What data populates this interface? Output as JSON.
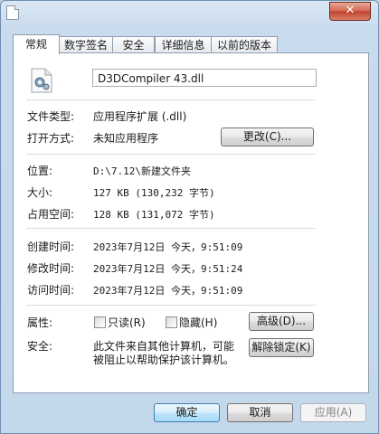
{
  "window": {
    "close_label": "✕"
  },
  "tabs": [
    {
      "label": "常规",
      "active": true
    },
    {
      "label": "数字签名"
    },
    {
      "label": "安全"
    },
    {
      "label": "详细信息"
    },
    {
      "label": "以前的版本"
    }
  ],
  "general": {
    "filename": "D3DCompiler 43.dll",
    "file_type_label": "文件类型:",
    "file_type_value": "应用程序扩展 (.dll)",
    "open_with_label": "打开方式:",
    "open_with_value": "未知应用程序",
    "change_button": "更改(C)...",
    "location_label": "位置:",
    "location_value": "D:\\7.12\\新建文件夹",
    "size_label": "大小:",
    "size_value": "127 KB (130,232 字节)",
    "size_on_disk_label": "占用空间:",
    "size_on_disk_value": "128 KB (131,072 字节)",
    "created_label": "创建时间:",
    "created_value": "2023年7月12日 今天，9:51:09",
    "modified_label": "修改时间:",
    "modified_value": "2023年7月12日 今天，9:51:24",
    "accessed_label": "访问时间:",
    "accessed_value": "2023年7月12日 今天，9:51:09",
    "attributes_label": "属性:",
    "readonly_label": "只读(R)",
    "hidden_label": "隐藏(H)",
    "advanced_button": "高级(D)...",
    "security_label": "安全:",
    "security_text_line1": "此文件来自其他计算机，可能",
    "security_text_line2": "被阻止以帮助保护该计算机。",
    "unblock_button": "解除锁定(K)"
  },
  "footer": {
    "ok_button": "确定",
    "cancel_button": "取消",
    "apply_button": "应用(A)"
  },
  "icons": {
    "title": "file-icon",
    "dll": "dll-gear-file-icon"
  }
}
